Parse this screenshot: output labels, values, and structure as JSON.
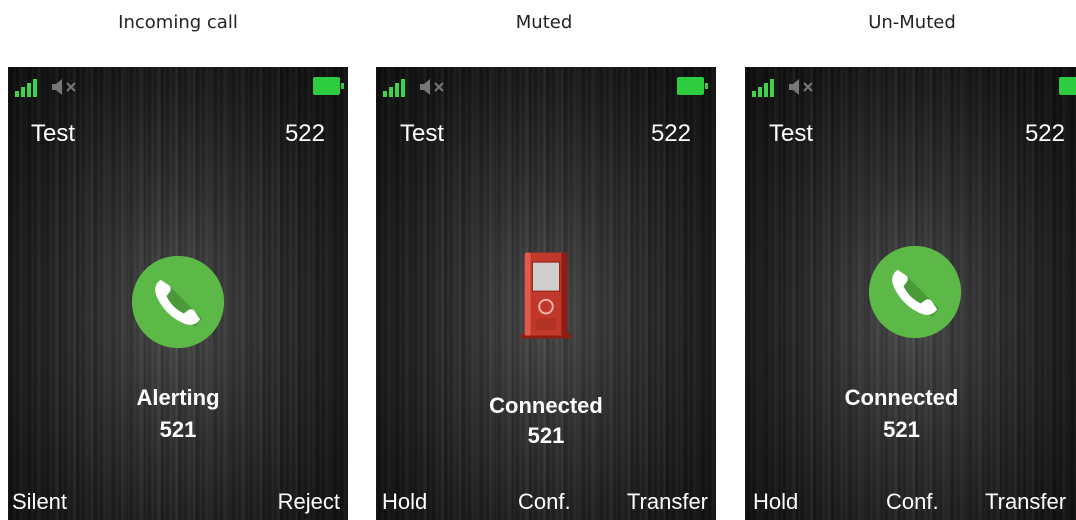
{
  "captions": [
    "Incoming call",
    "Muted",
    "Un-Muted"
  ],
  "colors": {
    "signal": "#3fd24a",
    "battery": "#2ecc40",
    "call_circle": "#5cb847",
    "muted_phone": "#c0392b",
    "text": "#ffffff"
  },
  "screens": [
    {
      "icons": [
        "signal-icon",
        "speaker-muted-icon",
        "battery-icon",
        "call-circle-icon"
      ],
      "name": "Test",
      "extension": "522",
      "status": "Alerting",
      "number": "521",
      "softkeys": {
        "left": "Silent",
        "middle": "",
        "right": "Reject"
      }
    },
    {
      "icons": [
        "signal-icon",
        "speaker-muted-icon",
        "battery-icon",
        "muted-phone-icon"
      ],
      "name": "Test",
      "extension": "522",
      "status": "Connected",
      "number": "521",
      "softkeys": {
        "left": "Hold",
        "middle": "Conf.",
        "right": "Transfer"
      }
    },
    {
      "icons": [
        "signal-icon",
        "speaker-muted-icon",
        "battery-icon",
        "call-circle-icon"
      ],
      "name": "Test",
      "extension": "522",
      "status": "Connected",
      "number": "521",
      "softkeys": {
        "left": "Hold",
        "middle": "Conf.",
        "right": "Transfer"
      }
    }
  ]
}
